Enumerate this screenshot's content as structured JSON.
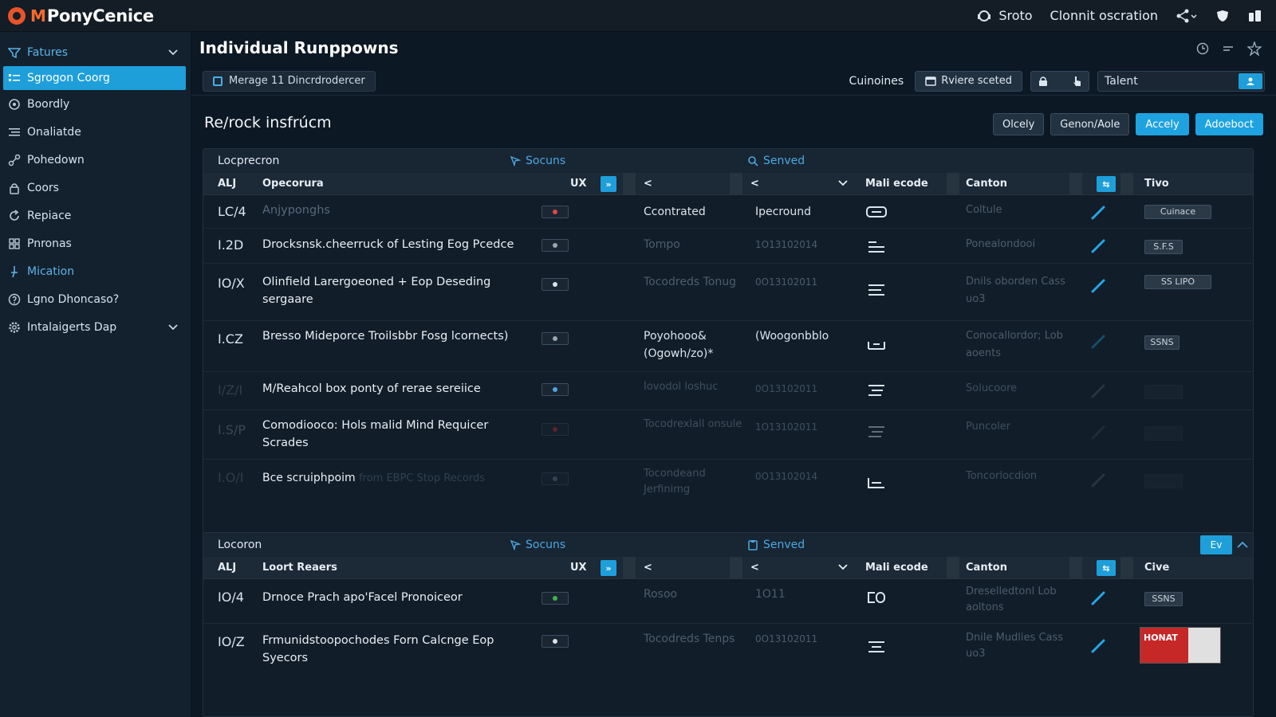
{
  "app": {
    "name": "PonyCenice",
    "brand_mark": "M"
  },
  "topbar": {
    "items": [
      {
        "icon": "support-icon",
        "label": "Sroto"
      },
      {
        "label": "Clonnit oscration"
      }
    ]
  },
  "sidebar": {
    "items": [
      {
        "label": "Fatures",
        "icon": "filter-icon",
        "type": "section",
        "chevron": true
      },
      {
        "label": "Sgrogon Coorg",
        "icon": "list-icon",
        "type": "active"
      },
      {
        "label": "Boordly",
        "icon": "circle-icon"
      },
      {
        "label": "Onaliatde",
        "icon": "lines-icon"
      },
      {
        "label": "Pohedown",
        "icon": "node-icon"
      },
      {
        "label": "Coors",
        "icon": "lock-icon"
      },
      {
        "label": "Repiace",
        "icon": "refresh-icon"
      },
      {
        "label": "Pnronas",
        "icon": "grid-icon"
      },
      {
        "label": "Mication",
        "icon": "pin-icon",
        "type": "section"
      },
      {
        "label": "Lgno Dhoncaso?",
        "icon": "help-icon"
      },
      {
        "label": "Intalaigerts Dap",
        "icon": "gear-icon",
        "chevron": true
      }
    ]
  },
  "main": {
    "title": "Individual Runppowns",
    "toolbar": {
      "chip": "Merage 11  Dincrdrodercer",
      "label": "Cuinoines",
      "review_button": "Rviere sceted",
      "talent_value": "Talent"
    },
    "subtitle": "Re/rock insfrúcm",
    "actions": [
      "Olcely",
      "Genon/Aole",
      "Accely",
      "Adoeboct"
    ]
  },
  "panels": [
    {
      "title": "Locprecron",
      "tag_sources": "Socuns",
      "tag_served": "Senved",
      "columns": {
        "all": "ALJ",
        "desc": "Opecorura",
        "ux": "UX",
        "mail": "Mali ecode",
        "content": "Canton",
        "time": "Tivo"
      },
      "rows": [
        {
          "id": "LC/4",
          "desc": "Anjyponghs",
          "ux": "#e04848",
          "src": "Ccontrated",
          "date": "Ipecround",
          "content": "Coltule",
          "time": "Cuinace"
        },
        {
          "id": "I.2D",
          "desc": "Drocksnsk.cheerruck of Lesting Eog Pcedce",
          "ux": "#9aa7b3",
          "src": "Tompo",
          "date": "1O13102014",
          "content": "Ponealondooi",
          "time": "S.F.S"
        },
        {
          "id": "IO/X",
          "desc": "Olinfield Larergoeoned + Eop Deseding sergaare",
          "ux": "#d9e3ec",
          "src": "Tocodreds Tonug",
          "date": "0O13102011",
          "content": "Dnils oborden Cass uo3",
          "time": "SS LIPO"
        },
        {
          "id": "I.CZ",
          "desc": "Bresso Mideporce Troilsbbr Fosg lcornects)",
          "ux": "#9aa7b3",
          "src": "Poyohooo& (Ogowh/zo)*",
          "date": "(Woogonbblo",
          "content": "Conocallordor; Lob aoents",
          "time": "SSNS"
        },
        {
          "id": "I/Z/I",
          "desc": "M/Reahcol box ponty of rerae sereiice",
          "ux": "#4aa9e0",
          "src": "Iovodol loshuc",
          "date": "0O13102011",
          "content": "Solucoore",
          "time": ""
        },
        {
          "id": "I.S/P",
          "desc": "Comodiooco: Hols malid Mind Requicer Scrades",
          "ux": "#c8302e",
          "src": "Tocodrexlall onsule",
          "date": "1O13102011",
          "content": "Puncoler",
          "time": ""
        },
        {
          "id": "I.O/I",
          "desc": "Bce scruiphpoim",
          "desc_faded": "from EBPC Stop Records",
          "ux": "#6d7b88",
          "src": "Tocondeand Jerfinimg",
          "date": "0O13102014",
          "content": "Toncorlocdion",
          "time": ""
        }
      ]
    },
    {
      "title": "Locoron",
      "tag_sources": "Socuns",
      "tag_served": "Senved",
      "header_button": "Ev",
      "columns": {
        "all": "ALJ",
        "desc": "Loort Reaers",
        "ux": "UX",
        "mail": "Mali ecode",
        "content": "Canton",
        "time": "Cive"
      },
      "rows": [
        {
          "id": "IO/4",
          "desc": "Drnoce Prach apo'Facel Pronoiceor",
          "ux": "#3bb54a",
          "src": "Rosoo",
          "date": "1O11",
          "content": "Dreselledtonl Lob aoltons",
          "time": "SSNS"
        },
        {
          "id": "IO/Z",
          "desc": "Frmunidstoopochodes Forn Calcnge Eop Syecors",
          "ux": "#d9e3ec",
          "src": "Tocodreds Tenps",
          "date": "0O13102011",
          "content": "Dnile Mudlies Cass uo3",
          "image_badge": "HONAT"
        }
      ]
    }
  ]
}
